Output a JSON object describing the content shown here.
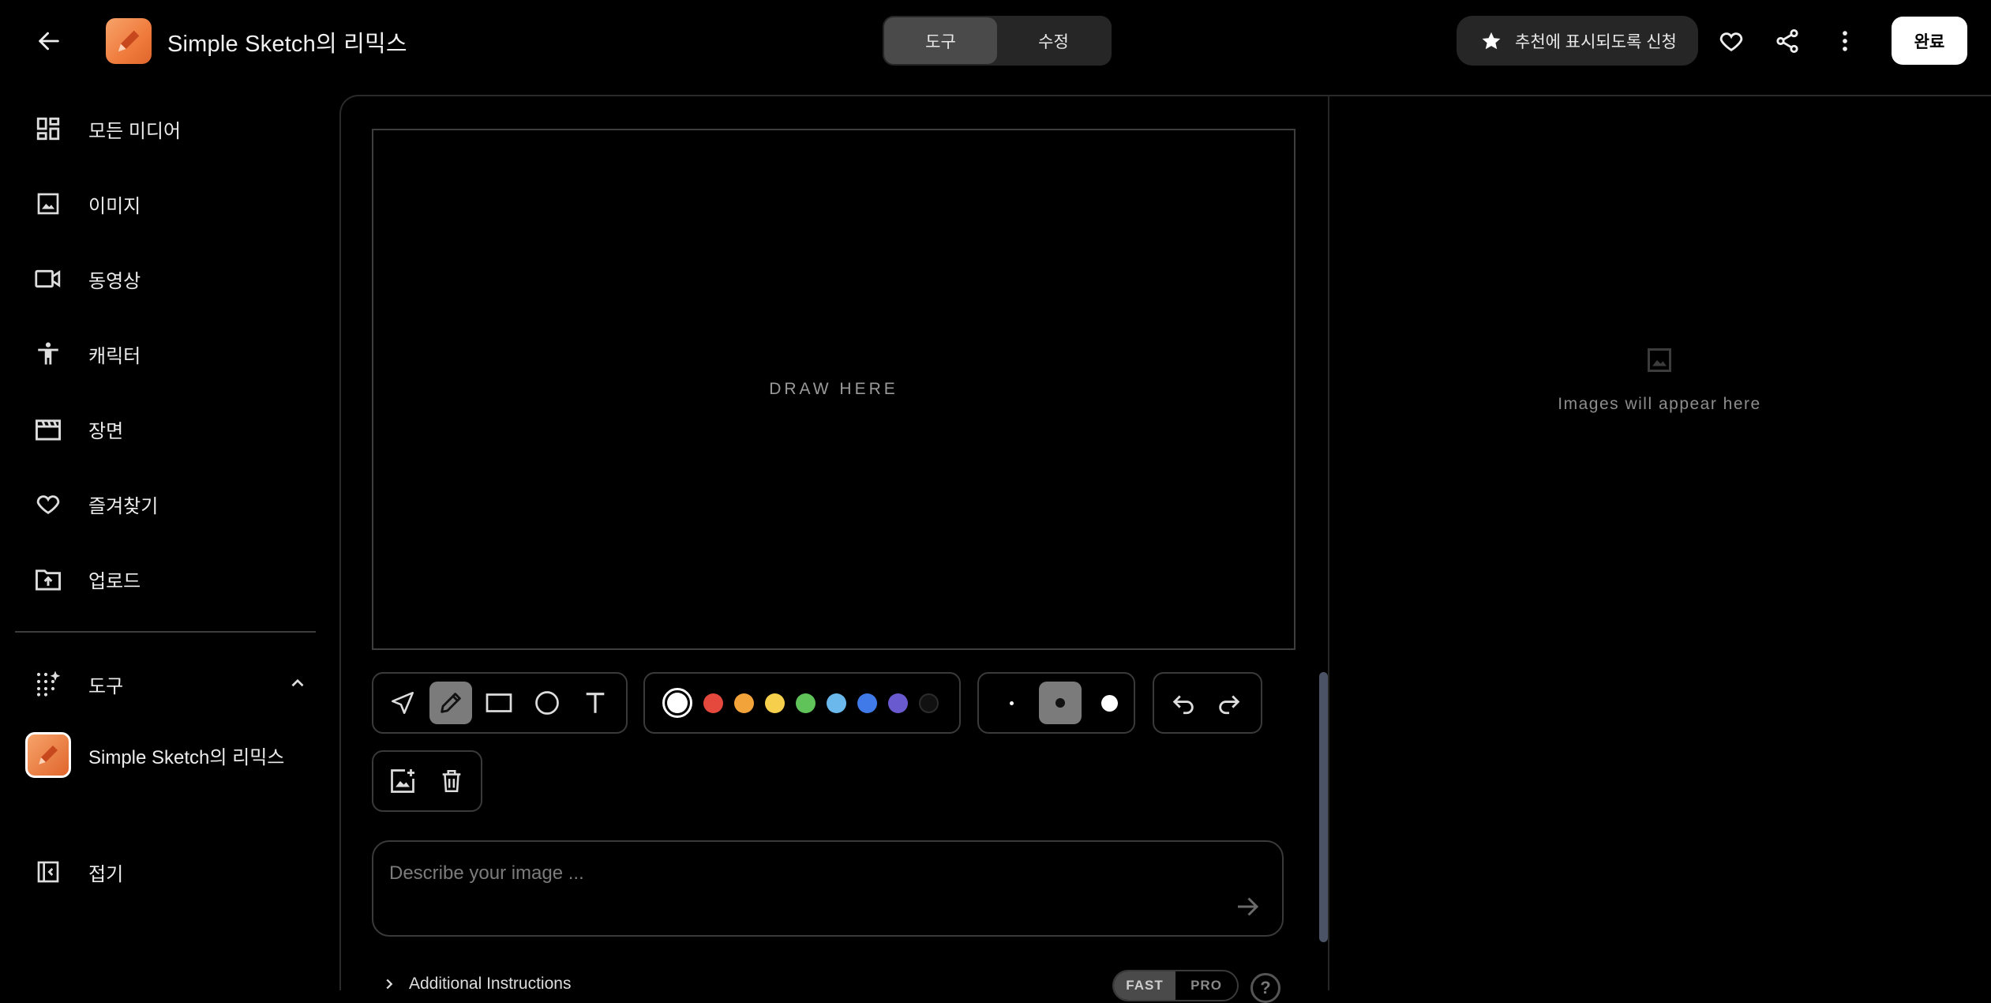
{
  "header": {
    "title": "Simple Sketch의 리믹스",
    "tabs": [
      {
        "label": "도구",
        "active": true
      },
      {
        "label": "수정",
        "active": false
      }
    ],
    "suggest_label": "추천에 표시되도록 신청",
    "done_label": "완료",
    "icons": [
      "back-arrow-icon",
      "heart-icon",
      "share-icon",
      "more-vert-icon",
      "star-icon"
    ]
  },
  "sidebar": {
    "items": [
      {
        "label": "모든 미디어",
        "icon": "grid-icon"
      },
      {
        "label": "이미지",
        "icon": "image-icon"
      },
      {
        "label": "동영상",
        "icon": "video-icon"
      },
      {
        "label": "캐릭터",
        "icon": "person-icon"
      },
      {
        "label": "장면",
        "icon": "clapperboard-icon"
      },
      {
        "label": "즐겨찾기",
        "icon": "heart-icon"
      },
      {
        "label": "업로드",
        "icon": "upload-icon"
      }
    ],
    "tools_section": {
      "label": "도구",
      "expanded": true
    },
    "tool_item": {
      "label": "Simple Sketch의 리믹스"
    },
    "collapse_label": "접기"
  },
  "editor": {
    "canvas_placeholder": "DRAW HERE",
    "draw_tools": [
      "select",
      "pen",
      "rectangle",
      "circle",
      "text"
    ],
    "active_tool": "pen",
    "colors": [
      "#ffffff",
      "#e5483c",
      "#f2a33a",
      "#f6d04d",
      "#5fc35a",
      "#6ab8ec",
      "#3f7ae8",
      "#6a5ad0",
      "#111111"
    ],
    "selected_color": "#ffffff",
    "brush_sizes": [
      "small",
      "medium",
      "large"
    ],
    "selected_size": "medium",
    "prompt_placeholder": "Describe your image ...",
    "additional_instructions_label": "Additional Instructions",
    "speed_options": [
      {
        "label": "FAST",
        "active": true
      },
      {
        "label": "PRO",
        "active": false
      }
    ],
    "help_label": "?"
  },
  "results": {
    "empty_text": "Images will appear here"
  }
}
